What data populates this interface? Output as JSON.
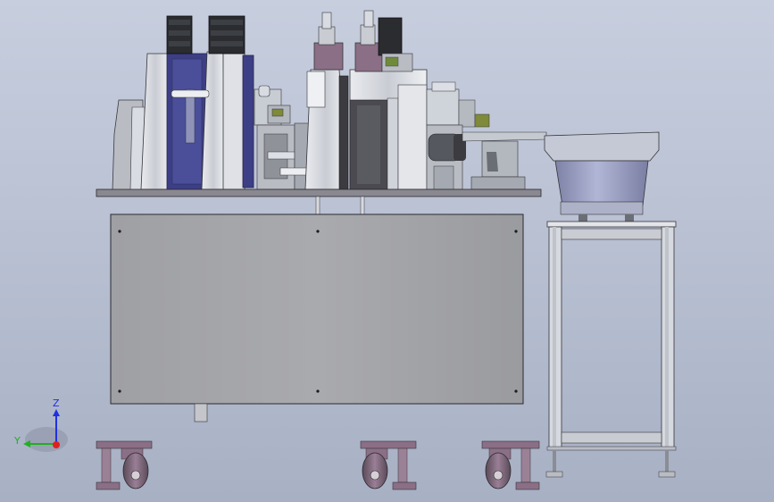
{
  "viewport": {
    "background_top": "#c7cede",
    "background_bottom": "#a8b0c4"
  },
  "colors": {
    "frame_gray": "#a3a3a6",
    "dark_steel": "#3b3b40",
    "motor_black": "#2a2c30",
    "navy_plate": "#3c3f86",
    "violet_part": "#8b6f86",
    "light_steel": "#cfd3da",
    "bowl_blue": "#9ea3c6",
    "axis_x": "#e02020",
    "axis_y": "#20b020",
    "axis_z": "#2030e0"
  },
  "triad": {
    "z_label": "Z",
    "y_label": "Y"
  },
  "icons": [
    "orientation-triad-icon"
  ]
}
